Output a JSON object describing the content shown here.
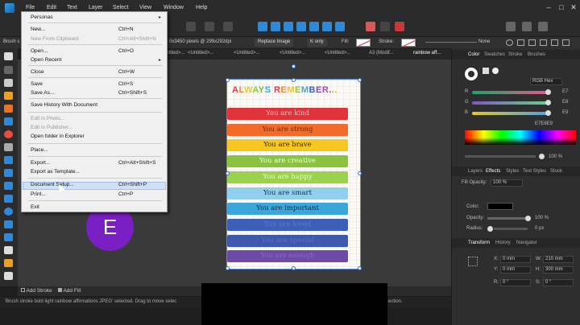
{
  "menubar": {
    "items": [
      "File",
      "Edit",
      "Text",
      "Layer",
      "Select",
      "View",
      "Window",
      "Help"
    ]
  },
  "context_bar": {
    "tool_name": "Brush s",
    "doc_info": "0x3450 pixels @ 299x292dpi",
    "replace_image": "Replace Image",
    "k_only": "K only",
    "fill_label": "Fill:",
    "stroke_label": "Stroke:",
    "none_label": "None"
  },
  "tabs": [
    "<Untitled>...",
    "<Untitled>...",
    "<Untitled>...",
    "<Untitled>...",
    "<Untitled>...",
    "A3 (Modif...",
    "rainbow aff..."
  ],
  "file_menu": {
    "items": [
      {
        "label": "Personas",
        "shortcut": "",
        "disabled": false,
        "submenu": true
      },
      {
        "label": "New...",
        "shortcut": "Ctrl+N",
        "disabled": false
      },
      {
        "label": "New From Clipboard",
        "shortcut": "Ctrl+Alt+Shift+N",
        "disabled": true
      },
      {
        "label": "Open...",
        "shortcut": "Ctrl+O",
        "disabled": false
      },
      {
        "label": "Open Recent",
        "shortcut": "",
        "disabled": false,
        "submenu": true
      },
      {
        "label": "Close",
        "shortcut": "Ctrl+W",
        "disabled": false
      },
      {
        "label": "Save",
        "shortcut": "Ctrl+S",
        "disabled": false
      },
      {
        "label": "Save As...",
        "shortcut": "Ctrl+Shift+S",
        "disabled": false
      },
      {
        "label": "Save History With Document",
        "shortcut": "",
        "disabled": false
      },
      {
        "label": "Edit in Photo...",
        "shortcut": "",
        "disabled": true
      },
      {
        "label": "Edit in Publisher...",
        "shortcut": "",
        "disabled": true
      },
      {
        "label": "Open folder in Explorer",
        "shortcut": "",
        "disabled": false
      },
      {
        "label": "Place...",
        "shortcut": "",
        "disabled": false
      },
      {
        "label": "Export...",
        "shortcut": "Ctrl+Alt+Shift+S",
        "disabled": false
      },
      {
        "label": "Export as Template...",
        "shortcut": "",
        "disabled": false
      },
      {
        "label": "Document Setup...",
        "shortcut": "Ctrl+Shift+P",
        "disabled": false,
        "highlighted": true
      },
      {
        "label": "Print...",
        "shortcut": "Ctrl+P",
        "disabled": false
      },
      {
        "label": "Exit",
        "shortcut": "",
        "disabled": false
      }
    ]
  },
  "poster": {
    "title": "ALWAYS REMEMBER...",
    "title_letters": [
      {
        "ch": "A",
        "color": "#e63946"
      },
      {
        "ch": "L",
        "color": "#f08a24"
      },
      {
        "ch": "W",
        "color": "#f2c230"
      },
      {
        "ch": "A",
        "color": "#8cc63f"
      },
      {
        "ch": "Y",
        "color": "#6bbf59"
      },
      {
        "ch": "S",
        "color": "#3fa9d6"
      },
      {
        "ch": " ",
        "color": "#000"
      },
      {
        "ch": "R",
        "color": "#e63946"
      },
      {
        "ch": "E",
        "color": "#f08a24"
      },
      {
        "ch": "M",
        "color": "#f2c230"
      },
      {
        "ch": "E",
        "color": "#8cc63f"
      },
      {
        "ch": "M",
        "color": "#3fa9d6"
      },
      {
        "ch": "B",
        "color": "#3d5fb8"
      },
      {
        "ch": "E",
        "color": "#7b4bb0"
      },
      {
        "ch": "R",
        "color": "#b04b9c"
      },
      {
        "ch": ".",
        "color": "#e63946"
      },
      {
        "ch": ".",
        "color": "#f08a24"
      },
      {
        "ch": ".",
        "color": "#f2c230"
      }
    ],
    "affirmations": [
      {
        "text": "You are kind",
        "color": "#e2333a",
        "text_color": "#f7b9b9"
      },
      {
        "text": "You are strong",
        "color": "#f26b2a",
        "text_color": "#6b2a0a"
      },
      {
        "text": "You are brave",
        "color": "#f6c623",
        "text_color": "#2e2a10"
      },
      {
        "text": "You are creative",
        "color": "#8ac33f",
        "text_color": "#f4ffe6"
      },
      {
        "text": "You are happy",
        "color": "#9bd24b",
        "text_color": "#e9f9d2"
      },
      {
        "text": "You are smart",
        "color": "#8fd0ee",
        "text_color": "#1d2b3a"
      },
      {
        "text": "You are important",
        "color": "#3aa6dc",
        "text_color": "#0d2f48"
      },
      {
        "text": "You are loved",
        "color": "#3d5fb8",
        "text_color": "#5a7bd1"
      },
      {
        "text": "You are special",
        "color": "#3e58ad",
        "text_color": "#5b72c2"
      },
      {
        "text": "You are enough",
        "color": "#6d49a8",
        "text_color": "#8b6ac2"
      }
    ]
  },
  "bottom_bar": {
    "add_stroke": "Add Stroke",
    "add_fill": "Add Fill"
  },
  "status_bar": {
    "message": "'Brush stroke bold light rainbow affirmations JPEG' selected. Drag to move selec",
    "message_tail": "ection."
  },
  "color_panel": {
    "tabs": [
      "Color",
      "Swatches",
      "Stroke",
      "Brushes"
    ],
    "model": "RGB Hex",
    "r_value": "E7",
    "g_value": "E8",
    "b_value": "E9",
    "hex_value": "E7E8E9",
    "opacity_label": "100 %"
  },
  "effects_panel": {
    "tabs": [
      "Layers",
      "Effects",
      "Styles",
      "Text Styles",
      "Stock"
    ],
    "fill_opacity_label": "Fill Opacity:",
    "fill_opacity_value": "100 %",
    "color_label": "Color:",
    "opacity_label": "Opacity:",
    "opacity_value": "100 %",
    "radius_label": "Radius:",
    "radius_value": "0 px"
  },
  "transform_panel": {
    "tabs": [
      "Transform",
      "History",
      "Navigator"
    ],
    "x_label": "X:",
    "x_value": "0 mm",
    "y_label": "Y:",
    "y_value": "0 mm",
    "w_label": "W:",
    "w_value": "210 mm",
    "h_label": "H:",
    "h_value": "300 mm",
    "r_label": "R:",
    "r_value": "0 °",
    "s_label": "S:",
    "s_value": "0 °"
  },
  "avatar": {
    "letter": "E",
    "color": "#7a1fc4"
  },
  "colors": {
    "menu_highlight": "#cfe0f7",
    "selection_handle": "#3a6fd0",
    "app_background": "#1e1e1e"
  }
}
